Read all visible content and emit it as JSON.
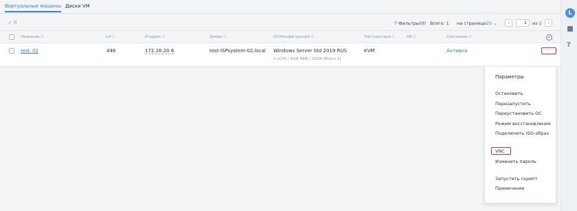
{
  "tabs": [
    {
      "label": "Виртуальные машины",
      "active": true
    },
    {
      "label": "Диски VM",
      "active": false
    }
  ],
  "toolbar": {
    "selected_count": "0",
    "filters": "Фильтры(0)",
    "total": "Всего: 1",
    "per_page_label": "на странице:",
    "per_page_value": "25",
    "page_input": "1",
    "page_of": "из 1"
  },
  "columns": [
    "Название",
    "id",
    "IP-адрес",
    "Домен",
    "ОС/Конфигурация",
    "Тип кластера",
    "HA",
    "Состояние"
  ],
  "rows": [
    {
      "name": "test_02",
      "id": "446",
      "ip": "172.16.20.6",
      "domain": "test-ISPsystem-02.local",
      "os": "Windows Server Std 2019 RUS",
      "config": "2 vCPU / 6GB RAM / 30GB (Всего 1)",
      "cluster_type": "KVM",
      "ha": "",
      "status": "Активна"
    }
  ],
  "menu": {
    "title": "Параметры",
    "groups": [
      [
        "Остановить",
        "Перезапустить",
        "Переустановить ОС",
        "Режим восстановления",
        "Подключить ISO-образ"
      ],
      [
        "VNC",
        "Изменить пароль"
      ],
      [
        "Запустить скрипт",
        "Примечание"
      ]
    ]
  },
  "user_initial": "L",
  "colors": {
    "accent": "#2f80ed",
    "status_active": "#2e9e4f",
    "highlight": "#e0302b"
  }
}
